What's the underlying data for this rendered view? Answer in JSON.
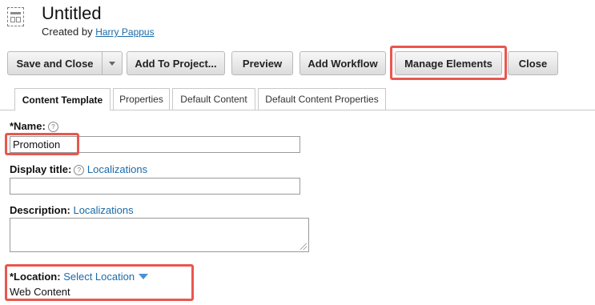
{
  "header": {
    "icon": "content-template-icon",
    "title": "Untitled",
    "created_by_prefix": "Created by",
    "author": "Harry Pappus"
  },
  "toolbar": {
    "save_close_label": "Save and Close",
    "add_to_project_label": "Add To Project...",
    "preview_label": "Preview",
    "add_workflow_label": "Add Workflow",
    "manage_elements_label": "Manage Elements",
    "close_label": "Close"
  },
  "tabs": [
    {
      "label": "Content Template",
      "active": true
    },
    {
      "label": "Properties",
      "active": false
    },
    {
      "label": "Default Content",
      "active": false
    },
    {
      "label": "Default Content Properties",
      "active": false
    }
  ],
  "form": {
    "name": {
      "label": "*Name:",
      "help": "?",
      "value": "Promotion"
    },
    "display_title": {
      "label": "Display title:",
      "help": "?",
      "link": "Localizations",
      "value": ""
    },
    "description": {
      "label": "Description:",
      "link": "Localizations",
      "value": ""
    },
    "location": {
      "label": "*Location:",
      "select_label": "Select Location",
      "value": "Web Content"
    }
  },
  "colors": {
    "highlight": "#e8574f",
    "link": "#1a6aa8"
  }
}
